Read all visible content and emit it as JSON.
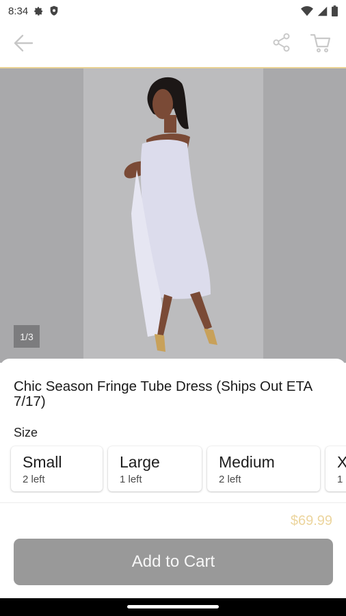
{
  "status_bar": {
    "time": "8:34",
    "icons": [
      "gear-icon",
      "shield-icon",
      "wifi-icon",
      "signal-icon",
      "battery-icon"
    ]
  },
  "app_bar": {
    "icons": [
      "back-arrow-icon",
      "share-icon",
      "cart-icon"
    ]
  },
  "gallery": {
    "counter": "1/3",
    "image_description_icon": "product-photo"
  },
  "product": {
    "title": "Chic Season Fringe Tube Dress (Ships Out ETA 7/17)",
    "size_label": "Size",
    "sizes": [
      {
        "name": "Small",
        "stock": "2 left"
      },
      {
        "name": "Large",
        "stock": "1 left"
      },
      {
        "name": "Medium",
        "stock": "2 left"
      },
      {
        "name": "X",
        "stock": "1"
      }
    ],
    "price": "$69.99",
    "cta_label": "Add to Cart"
  },
  "colors": {
    "accent_gold": "#e8d193",
    "price_gold": "#ecd59e",
    "cta_gray": "#999999"
  }
}
